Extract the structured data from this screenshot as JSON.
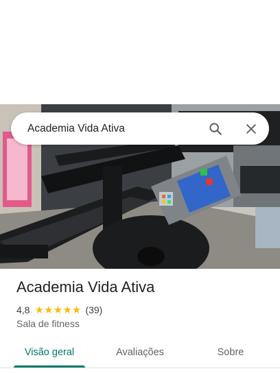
{
  "search": {
    "query": "Academia Vida Ativa"
  },
  "place": {
    "name": "Academia Vida Ativa",
    "rating": "4,8",
    "stars": 5,
    "review_count": "(39)",
    "category": "Sala de fitness"
  },
  "tabs": [
    {
      "label": "Visão geral",
      "active": true
    },
    {
      "label": "Avaliações",
      "active": false
    },
    {
      "label": "Sobre",
      "active": false
    }
  ],
  "colors": {
    "accent": "#00796b",
    "star": "#fbbc04"
  },
  "icons": {
    "search": "search-icon",
    "close": "close-icon",
    "star": "star-icon"
  }
}
